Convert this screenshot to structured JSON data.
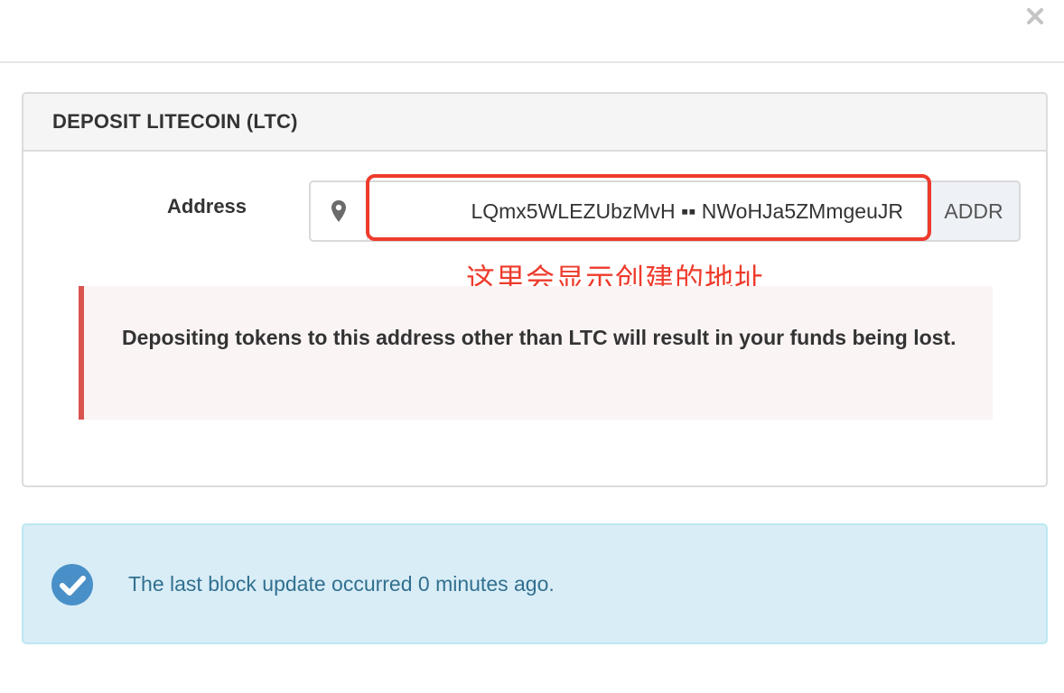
{
  "modal": {
    "close_icon": "close-icon"
  },
  "deposit_panel": {
    "title": "DEPOSIT LITECOIN (LTC)",
    "address_label": "Address",
    "address_icon": "map-marker-icon",
    "address_value": "LQmx5WLEZUbzMvH ▪▪ NWoHJa5ZMmgeuJR",
    "address_button": "ADDR",
    "warning_text": "Depositing tokens to this address other than LTC will result in your funds being lost."
  },
  "annotation": {
    "text": "这里会显示创建的地址",
    "color": "#ee3b2c"
  },
  "info_alert": {
    "icon": "check-circle-icon",
    "text": "The last block update occurred 0 minutes ago."
  },
  "colors": {
    "danger": "#d9534f",
    "info_text": "#31708f",
    "info_icon": "#4a90c8"
  }
}
